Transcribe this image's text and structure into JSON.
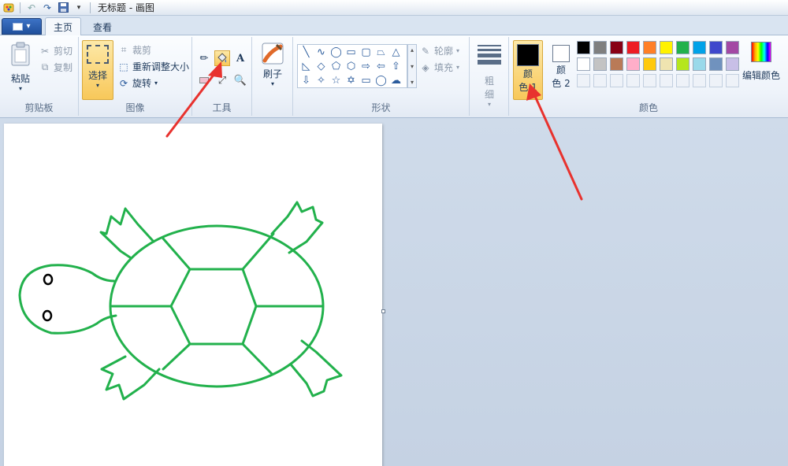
{
  "window": {
    "title": "无标题 - 画图"
  },
  "tabs": [
    {
      "label": "主页",
      "active": true
    },
    {
      "label": "查看",
      "active": false
    }
  ],
  "groups": {
    "clipboard": {
      "label": "剪贴板",
      "paste": "粘贴",
      "cut": "剪切",
      "copy": "复制"
    },
    "image": {
      "label": "图像",
      "select": "选择",
      "crop": "裁剪",
      "resize": "重新调整大小",
      "rotate": "旋转"
    },
    "tools": {
      "label": "工具"
    },
    "brush": {
      "label": "刷子"
    },
    "shapes": {
      "label": "形状",
      "outline": "轮廓",
      "fill": "填充"
    },
    "size": {
      "label_top": "粗",
      "label_bottom": "细"
    },
    "colors": {
      "label": "颜色",
      "color1_top": "颜",
      "color1_bottom": "色 1",
      "color2_top": "颜",
      "color2_bottom": "色 2",
      "edit": "编辑颜色",
      "palette_row1": [
        "#000000",
        "#7f7f7f",
        "#880015",
        "#ed1c24",
        "#ff7f27",
        "#fff200",
        "#22b14c",
        "#00a2e8",
        "#3f48cc",
        "#a349a4"
      ],
      "palette_row2": [
        "#ffffff",
        "#c3c3c3",
        "#b97a57",
        "#ffaec9",
        "#ffc90e",
        "#efe4b0",
        "#b5e61d",
        "#99d9ea",
        "#7092be",
        "#c8bfe7"
      ]
    }
  },
  "accent": {
    "drawing_green": "#22b14c",
    "arrow_red": "#e8322e"
  }
}
